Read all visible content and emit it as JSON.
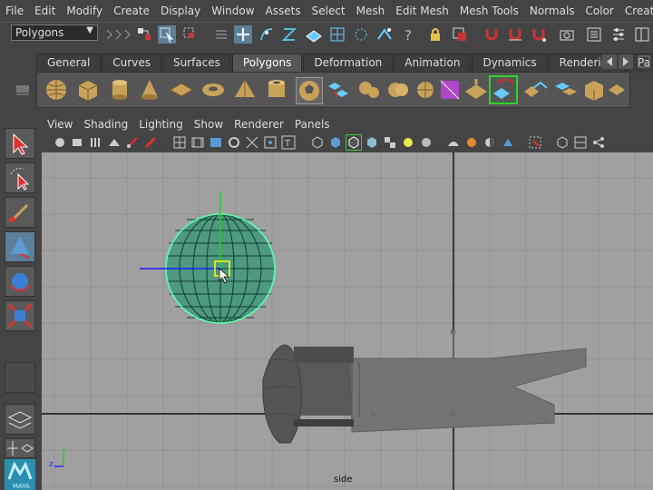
{
  "menubar": {
    "items": [
      "File",
      "Edit",
      "Modify",
      "Create",
      "Display",
      "Window",
      "Assets",
      "Select",
      "Mesh",
      "Edit Mesh",
      "Mesh Tools",
      "Normals",
      "Color",
      "Create UVs"
    ]
  },
  "status": {
    "mode": "Polygons"
  },
  "shelf": {
    "tabs": [
      "General",
      "Curves",
      "Surfaces",
      "Polygons",
      "Deformation",
      "Animation",
      "Dynamics",
      "Rendering",
      "Pa"
    ],
    "active_tab": "Polygons"
  },
  "viewport": {
    "menu": [
      "View",
      "Shading",
      "Lighting",
      "Show",
      "Renderer",
      "Panels"
    ],
    "camera_label": "side"
  },
  "axis": {
    "y": "y",
    "z": "z"
  },
  "logo": {
    "text": "MAYA"
  },
  "colors": {
    "wire": "#5dfcaa",
    "bg": "#a0a0a0",
    "mesh": "#6b6b6b",
    "highlight": "#ff0"
  }
}
